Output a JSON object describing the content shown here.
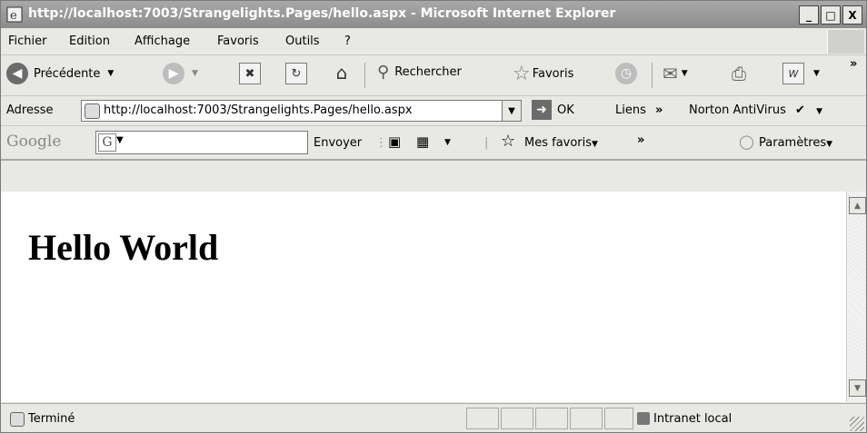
{
  "window": {
    "title": "http://localhost:7003/Strangelights.Pages/hello.aspx - Microsoft Internet Explorer",
    "minimize": "_",
    "maximize": "□",
    "close": "X"
  },
  "menu": [
    "Fichier",
    "Edition",
    "Affichage",
    "Favoris",
    "Outils",
    "?"
  ],
  "toolbar": {
    "back_label": "Précédente",
    "search_label": "Rechercher",
    "favorites_label": "Favoris",
    "overflow": "»"
  },
  "address": {
    "label": "Adresse",
    "url": "http://localhost:7003/Strangelights.Pages/hello.aspx",
    "go_label": "OK",
    "links_label": "Liens",
    "links_overflow": "»",
    "norton_label": "Norton AntiVirus"
  },
  "google": {
    "logo": "Google",
    "search_value": "",
    "send_label": "Envoyer",
    "bookmarks_label": "Mes favoris",
    "overflow": "»",
    "settings_label": "Paramètres"
  },
  "page": {
    "heading": "Hello World"
  },
  "status": {
    "text": "Terminé",
    "zone": "Intranet local"
  }
}
